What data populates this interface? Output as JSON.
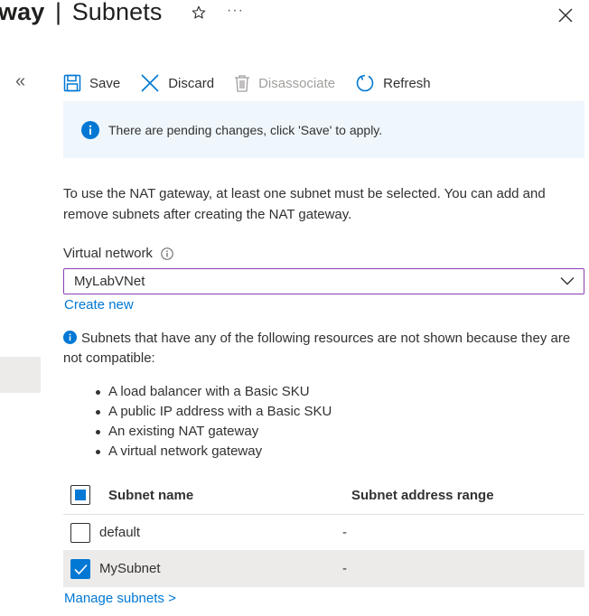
{
  "header": {
    "title_bold": "way",
    "title_sep": "|",
    "title_rest": "Subnets",
    "more_label": "···"
  },
  "sidebar": {
    "collapse_label": "«"
  },
  "toolbar": {
    "save_label": "Save",
    "discard_label": "Discard",
    "disassociate_label": "Disassociate",
    "refresh_label": "Refresh"
  },
  "banner": {
    "text": "There are pending changes, click 'Save' to apply."
  },
  "description": "To use the NAT gateway, at least one subnet must be selected. You can add and remove subnets after creating the NAT gateway.",
  "virtual_network": {
    "label": "Virtual network",
    "value": "MyLabVNet",
    "create_new": "Create new"
  },
  "note": {
    "text": "Subnets that have any of the following resources are not shown because they are not compatible:",
    "items": [
      "A load balancer with a Basic SKU",
      "A public IP address with a Basic SKU",
      "An existing NAT gateway",
      "A virtual network gateway"
    ]
  },
  "table": {
    "headers": [
      "Subnet name",
      "Subnet address range"
    ],
    "rows": [
      {
        "name": "default",
        "range": "-",
        "checked": false
      },
      {
        "name": "MySubnet",
        "range": "-",
        "checked": true
      }
    ]
  },
  "manage_link": "Manage subnets >",
  "colors": {
    "accent": "#0078d4",
    "banner_bg": "#eff6fc",
    "dropdown_border": "#8a3fb5",
    "selected_row": "#edebe9"
  }
}
